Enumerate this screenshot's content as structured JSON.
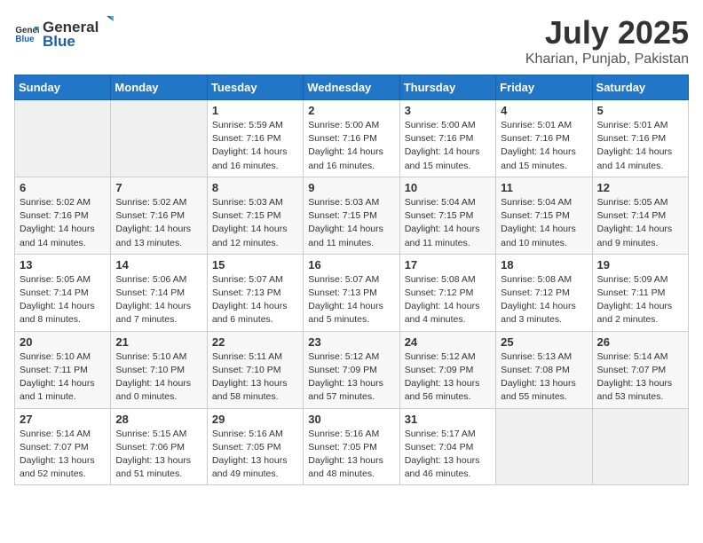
{
  "header": {
    "logo_general": "General",
    "logo_blue": "Blue",
    "month": "July 2025",
    "location": "Kharian, Punjab, Pakistan"
  },
  "weekdays": [
    "Sunday",
    "Monday",
    "Tuesday",
    "Wednesday",
    "Thursday",
    "Friday",
    "Saturday"
  ],
  "weeks": [
    [
      {
        "day": "",
        "empty": true
      },
      {
        "day": "",
        "empty": true
      },
      {
        "day": "1",
        "sunrise": "5:59 AM",
        "sunset": "7:16 PM",
        "daylight": "14 hours and 16 minutes."
      },
      {
        "day": "2",
        "sunrise": "5:00 AM",
        "sunset": "7:16 PM",
        "daylight": "14 hours and 16 minutes."
      },
      {
        "day": "3",
        "sunrise": "5:00 AM",
        "sunset": "7:16 PM",
        "daylight": "14 hours and 15 minutes."
      },
      {
        "day": "4",
        "sunrise": "5:01 AM",
        "sunset": "7:16 PM",
        "daylight": "14 hours and 15 minutes."
      },
      {
        "day": "5",
        "sunrise": "5:01 AM",
        "sunset": "7:16 PM",
        "daylight": "14 hours and 14 minutes."
      }
    ],
    [
      {
        "day": "6",
        "sunrise": "5:02 AM",
        "sunset": "7:16 PM",
        "daylight": "14 hours and 14 minutes."
      },
      {
        "day": "7",
        "sunrise": "5:02 AM",
        "sunset": "7:16 PM",
        "daylight": "14 hours and 13 minutes."
      },
      {
        "day": "8",
        "sunrise": "5:03 AM",
        "sunset": "7:15 PM",
        "daylight": "14 hours and 12 minutes."
      },
      {
        "day": "9",
        "sunrise": "5:03 AM",
        "sunset": "7:15 PM",
        "daylight": "14 hours and 11 minutes."
      },
      {
        "day": "10",
        "sunrise": "5:04 AM",
        "sunset": "7:15 PM",
        "daylight": "14 hours and 11 minutes."
      },
      {
        "day": "11",
        "sunrise": "5:04 AM",
        "sunset": "7:15 PM",
        "daylight": "14 hours and 10 minutes."
      },
      {
        "day": "12",
        "sunrise": "5:05 AM",
        "sunset": "7:14 PM",
        "daylight": "14 hours and 9 minutes."
      }
    ],
    [
      {
        "day": "13",
        "sunrise": "5:05 AM",
        "sunset": "7:14 PM",
        "daylight": "14 hours and 8 minutes."
      },
      {
        "day": "14",
        "sunrise": "5:06 AM",
        "sunset": "7:14 PM",
        "daylight": "14 hours and 7 minutes."
      },
      {
        "day": "15",
        "sunrise": "5:07 AM",
        "sunset": "7:13 PM",
        "daylight": "14 hours and 6 minutes."
      },
      {
        "day": "16",
        "sunrise": "5:07 AM",
        "sunset": "7:13 PM",
        "daylight": "14 hours and 5 minutes."
      },
      {
        "day": "17",
        "sunrise": "5:08 AM",
        "sunset": "7:12 PM",
        "daylight": "14 hours and 4 minutes."
      },
      {
        "day": "18",
        "sunrise": "5:08 AM",
        "sunset": "7:12 PM",
        "daylight": "14 hours and 3 minutes."
      },
      {
        "day": "19",
        "sunrise": "5:09 AM",
        "sunset": "7:11 PM",
        "daylight": "14 hours and 2 minutes."
      }
    ],
    [
      {
        "day": "20",
        "sunrise": "5:10 AM",
        "sunset": "7:11 PM",
        "daylight": "14 hours and 1 minute."
      },
      {
        "day": "21",
        "sunrise": "5:10 AM",
        "sunset": "7:10 PM",
        "daylight": "14 hours and 0 minutes."
      },
      {
        "day": "22",
        "sunrise": "5:11 AM",
        "sunset": "7:10 PM",
        "daylight": "13 hours and 58 minutes."
      },
      {
        "day": "23",
        "sunrise": "5:12 AM",
        "sunset": "7:09 PM",
        "daylight": "13 hours and 57 minutes."
      },
      {
        "day": "24",
        "sunrise": "5:12 AM",
        "sunset": "7:09 PM",
        "daylight": "13 hours and 56 minutes."
      },
      {
        "day": "25",
        "sunrise": "5:13 AM",
        "sunset": "7:08 PM",
        "daylight": "13 hours and 55 minutes."
      },
      {
        "day": "26",
        "sunrise": "5:14 AM",
        "sunset": "7:07 PM",
        "daylight": "13 hours and 53 minutes."
      }
    ],
    [
      {
        "day": "27",
        "sunrise": "5:14 AM",
        "sunset": "7:07 PM",
        "daylight": "13 hours and 52 minutes."
      },
      {
        "day": "28",
        "sunrise": "5:15 AM",
        "sunset": "7:06 PM",
        "daylight": "13 hours and 51 minutes."
      },
      {
        "day": "29",
        "sunrise": "5:16 AM",
        "sunset": "7:05 PM",
        "daylight": "13 hours and 49 minutes."
      },
      {
        "day": "30",
        "sunrise": "5:16 AM",
        "sunset": "7:05 PM",
        "daylight": "13 hours and 48 minutes."
      },
      {
        "day": "31",
        "sunrise": "5:17 AM",
        "sunset": "7:04 PM",
        "daylight": "13 hours and 46 minutes."
      },
      {
        "day": "",
        "empty": true
      },
      {
        "day": "",
        "empty": true
      }
    ]
  ]
}
